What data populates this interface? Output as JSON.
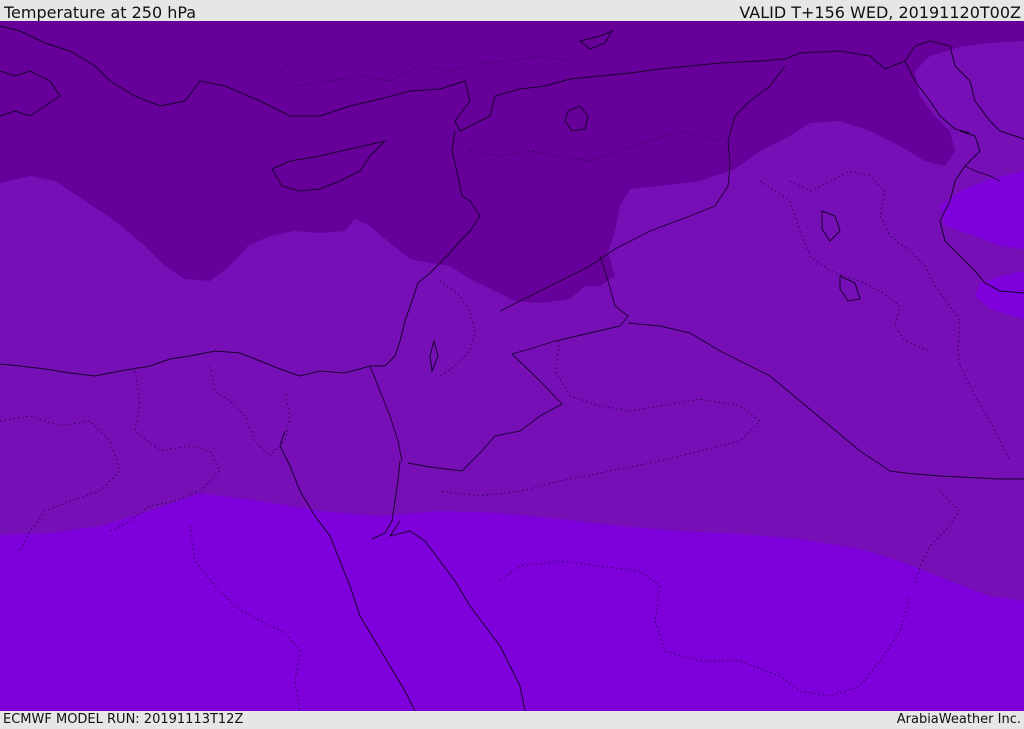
{
  "header": {
    "title": "Temperature at 250 hPa",
    "valid": "VALID T+156 WED, 20191120T00Z"
  },
  "footer": {
    "model_run": "ECMWF MODEL RUN: 20191113T12Z",
    "credit": "ArabiaWeather Inc."
  },
  "colors": {
    "band_cold": "#67009a",
    "band_mid": "#760fb5",
    "band_warm": "#7e00db",
    "band_mid_alt": "#7a0ec0"
  }
}
